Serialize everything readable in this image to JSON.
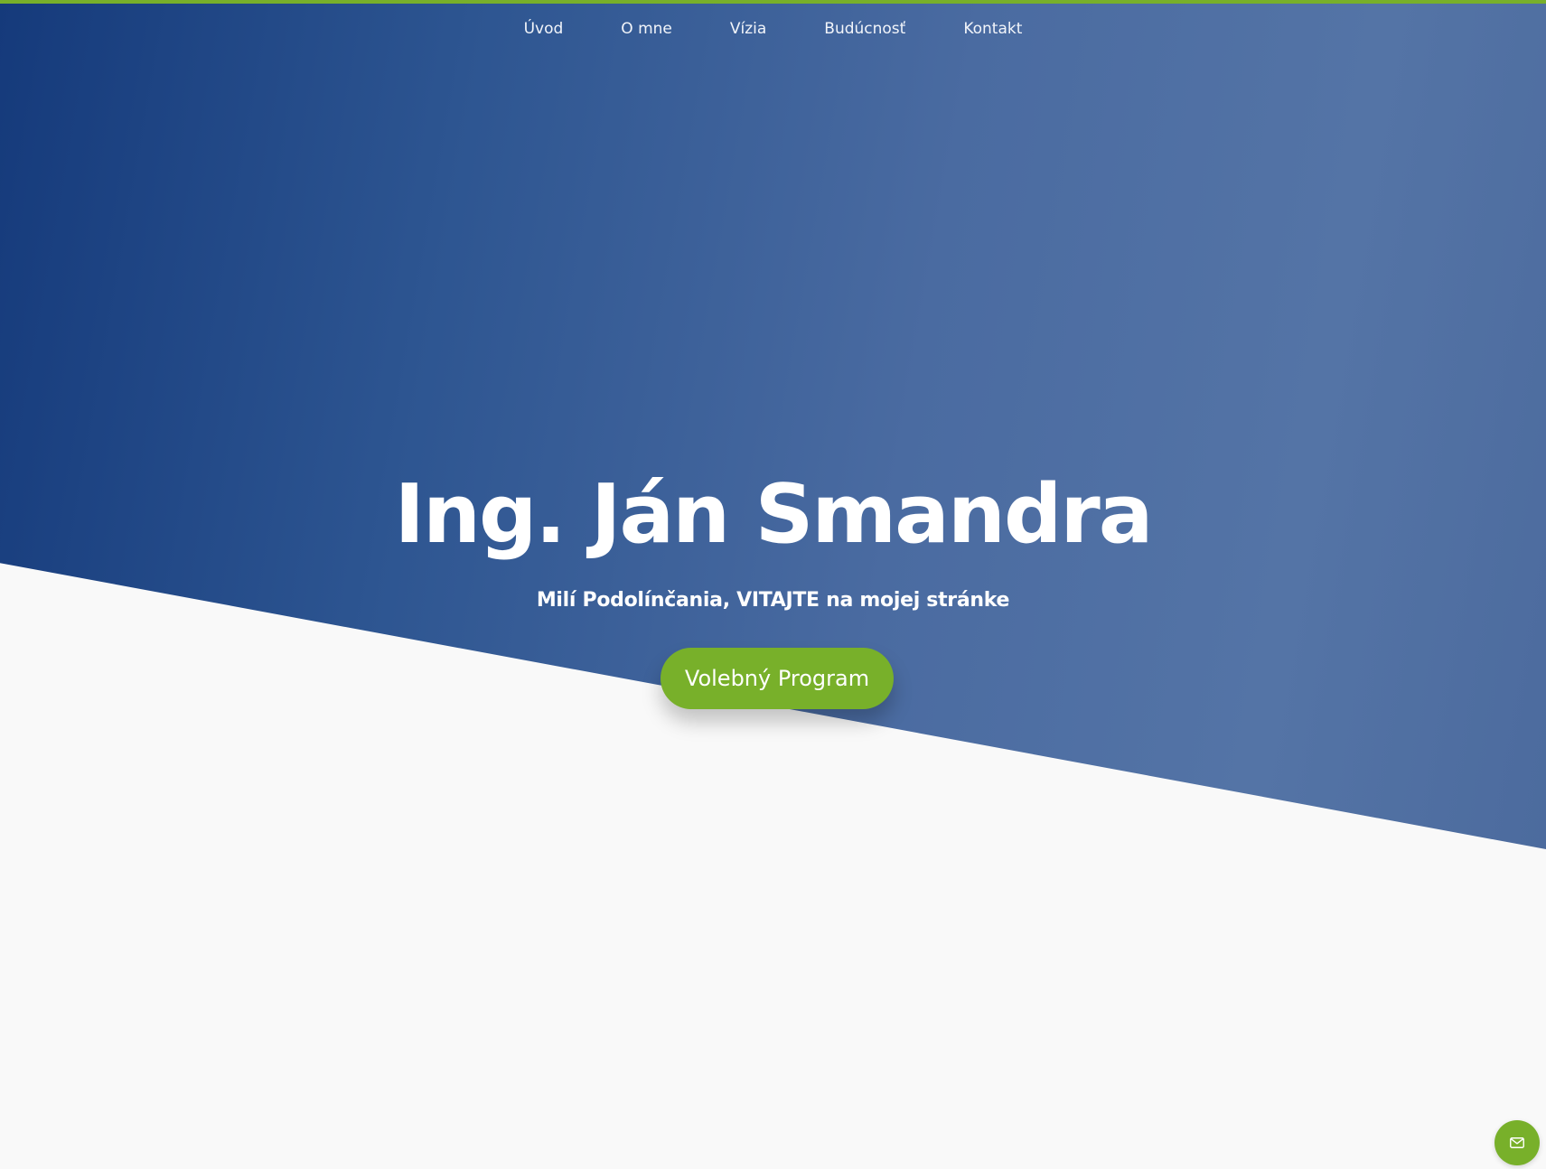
{
  "nav": {
    "items": [
      {
        "label": "Úvod"
      },
      {
        "label": "O mne"
      },
      {
        "label": "Vízia"
      },
      {
        "label": "Budúcnosť"
      },
      {
        "label": "Kontakt"
      }
    ]
  },
  "hero": {
    "title": "Ing. Ján Smandra",
    "subtitle": "Milí Podolínčania, VITAJTE na mojej stránke",
    "cta_label": "Volebný Program"
  },
  "floating": {
    "mail_icon": "mail-icon"
  },
  "colors": {
    "accent": "#78b02a",
    "hero_dark": "#153a7b",
    "hero_light": "#5474a6",
    "background": "#f9f9f9"
  }
}
